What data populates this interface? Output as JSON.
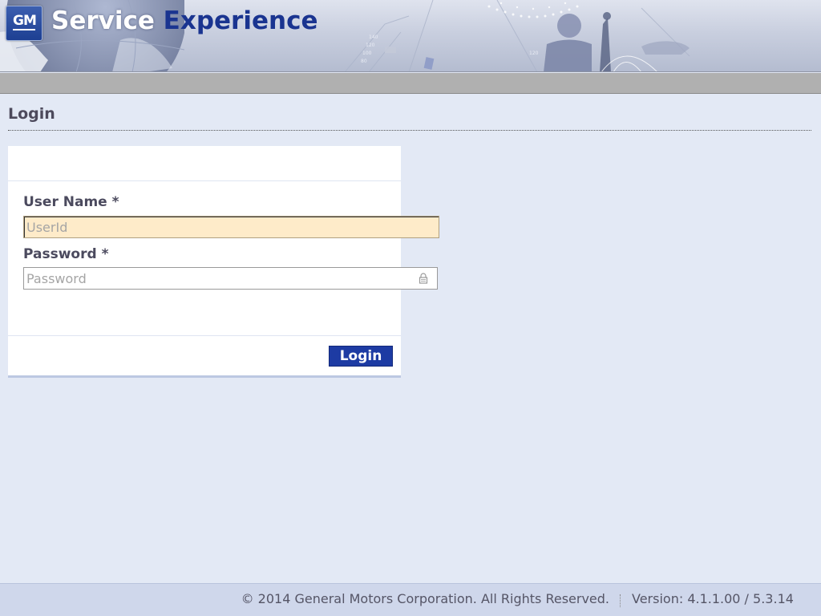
{
  "header": {
    "logo_text": "GM",
    "title_part1": "Service",
    "title_part2": "Experience"
  },
  "page": {
    "title": "Login"
  },
  "form": {
    "username_label": "User Name *",
    "username_placeholder": "UserId",
    "username_value": "",
    "password_label": "Password *",
    "password_placeholder": "Password",
    "password_value": "",
    "login_button": "Login"
  },
  "footer": {
    "copyright": "© 2014 General Motors Corporation. All Rights Reserved.",
    "version": "Version: 4.1.1.00 / 5.3.14"
  },
  "colors": {
    "page_bg": "#e3e9f5",
    "accent_blue": "#1d3ba3",
    "focused_input_bg": "#feebc9",
    "footer_bg": "#cfd7eb"
  },
  "icons": [
    "gm-logo",
    "lock-icon"
  ]
}
